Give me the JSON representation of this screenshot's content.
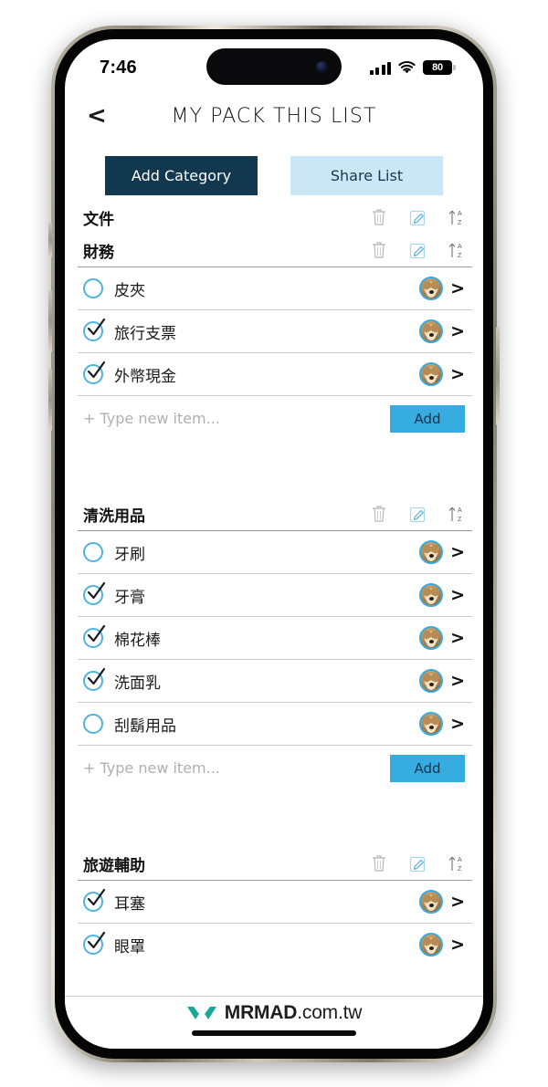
{
  "status_bar": {
    "time": "7:46",
    "signal_icon": "cellular-signal-icon",
    "wifi_icon": "wifi-icon",
    "battery_level": "80",
    "battery_icon": "battery-icon"
  },
  "nav": {
    "back_icon": "<",
    "title": "MY PACK THIS LIST"
  },
  "actions": {
    "add_category_label": "Add Category",
    "share_list_label": "Share List"
  },
  "colors": {
    "navy": "#12384f",
    "light_blue": "#cbe7f5",
    "accent_blue": "#36ace0",
    "check_ring": "#4eb3dd",
    "divider": "#c9c9c9"
  },
  "tools": {
    "delete_icon": "trash-icon",
    "edit_icon": "edit-pencil-icon",
    "sort_icon": "sort-az-icon"
  },
  "new_item": {
    "placeholder": "+ Type new item...",
    "value": "",
    "add_label": "Add"
  },
  "categories": [
    {
      "title": "文件",
      "items": [],
      "has_input": false
    },
    {
      "title": "財務",
      "items": [
        {
          "label": "皮夾",
          "checked": false,
          "avatar": "dog-avatar",
          "chevron": ">"
        },
        {
          "label": "旅行支票",
          "checked": true,
          "avatar": "dog-avatar",
          "chevron": ">"
        },
        {
          "label": "外幣現金",
          "checked": true,
          "avatar": "dog-avatar",
          "chevron": ">"
        }
      ],
      "has_input": true
    },
    {
      "title": "清洗用品",
      "items": [
        {
          "label": "牙刷",
          "checked": false,
          "avatar": "dog-avatar",
          "chevron": ">"
        },
        {
          "label": "牙膏",
          "checked": true,
          "avatar": "dog-avatar",
          "chevron": ">"
        },
        {
          "label": "棉花棒",
          "checked": true,
          "avatar": "dog-avatar",
          "chevron": ">"
        },
        {
          "label": "洗面乳",
          "checked": true,
          "avatar": "dog-avatar",
          "chevron": ">"
        },
        {
          "label": "刮鬍用品",
          "checked": false,
          "avatar": "dog-avatar",
          "chevron": ">"
        }
      ],
      "has_input": true
    },
    {
      "title": "旅遊輔助",
      "items": [
        {
          "label": "耳塞",
          "checked": true,
          "avatar": "dog-avatar",
          "chevron": ">"
        },
        {
          "label": "眼罩",
          "checked": true,
          "avatar": "dog-avatar",
          "chevron": ">"
        }
      ],
      "has_input": false
    }
  ],
  "watermark": {
    "brand_bold": "MRMAD",
    "brand_suffix": ".com.tw",
    "logo_icon": "mrmad-logo-icon",
    "logo_color": "#19a79b"
  }
}
